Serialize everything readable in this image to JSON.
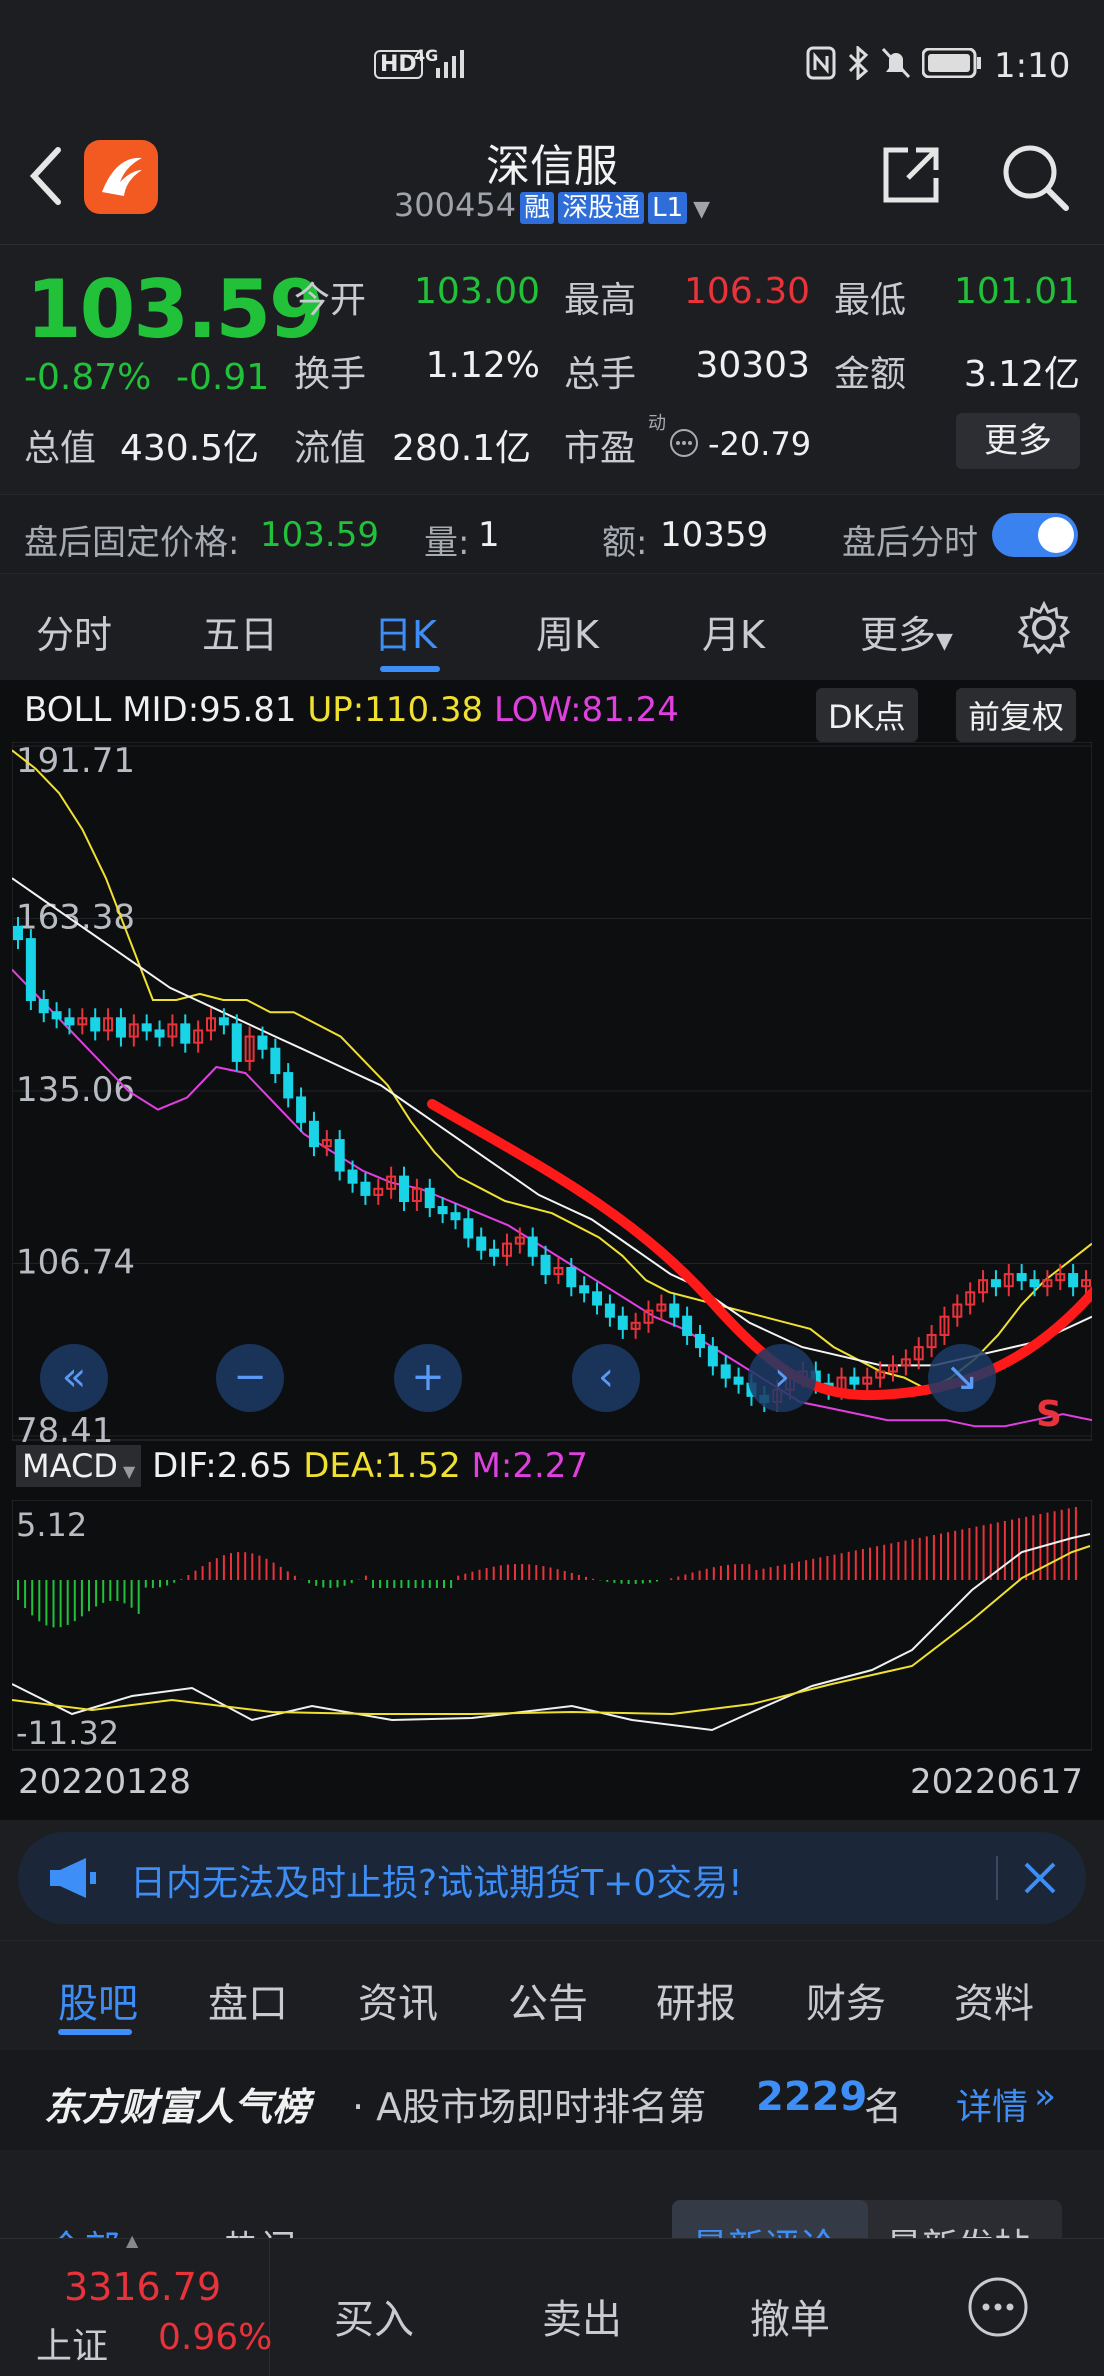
{
  "status_bar": {
    "network_left": "HD",
    "network_type": "4G",
    "time": "1:10"
  },
  "header": {
    "title": "深信服",
    "code": "300454",
    "tags": [
      "融",
      "深股通",
      "L1"
    ]
  },
  "quote": {
    "price": "103.59",
    "change_pct": "-0.87%",
    "change_abs": "-0.91",
    "open_label": "今开",
    "open": "103.00",
    "high_label": "最高",
    "high": "106.30",
    "low_label": "最低",
    "low": "101.01",
    "turnover_label": "换手",
    "turnover": "1.12%",
    "volume_label": "总手",
    "volume": "30303",
    "amount_label": "金额",
    "amount": "3.12亿",
    "mcap_label": "总值",
    "mcap": "430.5亿",
    "float_label": "流值",
    "float": "280.1亿",
    "pe_label": "市盈",
    "pe_sup": "动",
    "pe": "-20.79",
    "more_button": "更多"
  },
  "after_hours": {
    "price_label": "盘后固定价格:",
    "price": "103.59",
    "vol_label": "量:",
    "vol": "1",
    "amt_label": "额:",
    "amt": "10359",
    "toggle_label": "盘后分时"
  },
  "chart_tabs": [
    "分时",
    "五日",
    "日K",
    "周K",
    "月K",
    "更多"
  ],
  "active_tab": "日K",
  "boll": {
    "name": "BOLL",
    "mid": "MID:95.81",
    "up": "UP:110.38",
    "low": "LOW:81.24",
    "dk_button": "DK点",
    "adj_button": "前复权"
  },
  "price_axis": [
    "191.71",
    "163.38",
    "135.06",
    "106.74",
    "78.41"
  ],
  "macd": {
    "name": "MACD",
    "dif": "DIF:2.65",
    "dea": "DEA:1.52",
    "m": "M:2.27",
    "top": "5.12",
    "bottom": "-11.32"
  },
  "dates": {
    "start": "20220128",
    "end": "20220617"
  },
  "s_marker": "S",
  "banner": {
    "text": "日内无法及时止损?试试期货T+0交易!"
  },
  "sub_tabs": [
    "股吧",
    "盘口",
    "资讯",
    "公告",
    "研报",
    "财务",
    "资料"
  ],
  "popular": {
    "brand": "东方财富人气榜",
    "text": "· A股市场即时排名第",
    "rank": "2229",
    "unit": "名",
    "detail": "详情"
  },
  "filter": {
    "all": "全部",
    "hot": "热门",
    "latest_review": "最新评论",
    "latest_post": "最新发帖"
  },
  "bottom": {
    "index_value": "3316.79",
    "index_name": "上证",
    "index_change": "0.96%",
    "buy": "买入",
    "sell": "卖出",
    "cancel": "撤单"
  },
  "colors": {
    "up": "#e8333a",
    "down": "#21c23a",
    "accent": "#3e8ef7",
    "boll_up": "#f0e030",
    "boll_low": "#e040e0",
    "cyan_candle": "#19d4e6"
  },
  "chart_data": {
    "type": "candlestick",
    "title": "",
    "x_range": [
      "20220128",
      "20220617"
    ],
    "ylim": [
      78.41,
      191.71
    ],
    "closes": [
      160,
      150,
      148,
      147,
      146,
      147,
      145,
      147,
      144,
      146,
      145,
      144,
      146,
      143,
      145,
      147,
      146,
      140,
      144,
      142,
      138,
      134,
      130,
      126,
      127,
      122,
      120,
      118,
      119,
      121,
      117,
      119,
      116,
      115,
      114,
      111,
      109,
      108,
      110,
      111,
      108,
      105,
      106,
      103,
      102,
      100,
      98,
      96,
      97,
      99,
      100,
      98,
      95,
      93,
      90,
      88,
      87,
      85,
      84,
      86,
      88,
      89,
      87,
      86,
      88,
      87,
      88,
      89,
      90,
      91,
      93,
      95,
      98,
      100,
      102,
      104,
      103,
      105,
      104,
      103,
      104,
      105,
      103,
      104
    ],
    "boll_upper": [
      191,
      188,
      184,
      178,
      170,
      160,
      150,
      150,
      151,
      150,
      150,
      148,
      148,
      146,
      144,
      140,
      136,
      130,
      125,
      121,
      119,
      117,
      116,
      115,
      113,
      111,
      108,
      104,
      102,
      101,
      100,
      99,
      98,
      97,
      96,
      93,
      91,
      89,
      88,
      86,
      88,
      91,
      95,
      100,
      104,
      107,
      110
    ],
    "boll_mid": [
      170,
      167,
      164,
      161,
      158,
      155,
      152,
      150,
      148,
      146,
      144,
      142,
      140,
      138,
      136,
      133,
      130,
      127,
      124,
      121,
      118,
      116,
      114,
      111,
      108,
      105,
      103,
      100,
      97,
      95,
      93,
      92,
      91,
      90,
      90,
      90,
      91,
      92,
      93,
      94,
      96,
      98
    ],
    "boll_lower": [
      155,
      150,
      145,
      140,
      135,
      132,
      134,
      139,
      138,
      133,
      128,
      125,
      122,
      120,
      119,
      117,
      115,
      113,
      110,
      107,
      104,
      101,
      98,
      96,
      93,
      90,
      87,
      84,
      83,
      82,
      81,
      81,
      81,
      80,
      80,
      81,
      82,
      81
    ]
  }
}
